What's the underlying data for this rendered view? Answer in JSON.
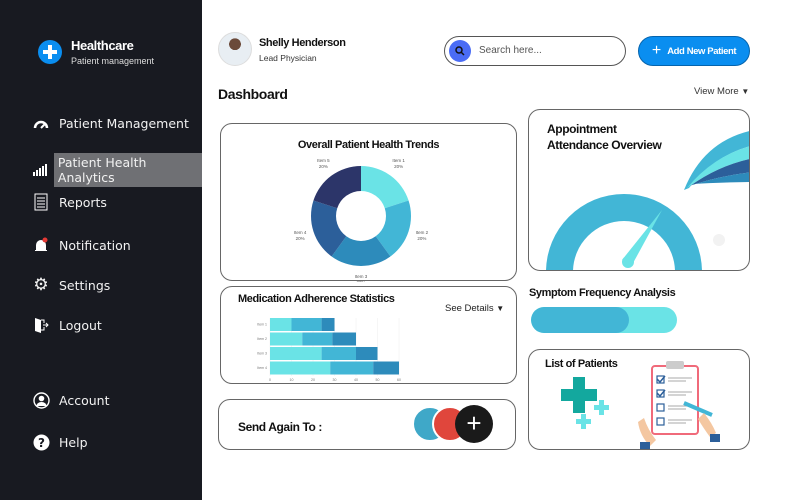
{
  "brand": {
    "title": "Healthcare",
    "subtitle": "Patient management",
    "icon": "plus-circle-icon"
  },
  "sidebar": {
    "items": [
      {
        "label": "Patient Management",
        "icon": "gauge-icon"
      },
      {
        "label": "Patient Health Analytics",
        "icon": "signal-bars-icon",
        "active": true
      },
      {
        "label": "Reports",
        "icon": "document-icon"
      },
      {
        "label": "Notification",
        "icon": "bell-icon"
      },
      {
        "label": "Settings",
        "icon": "gear-icon"
      },
      {
        "label": "Logout",
        "icon": "logout-door-icon"
      }
    ],
    "bottom": [
      {
        "label": "Account",
        "icon": "user-circle-icon"
      },
      {
        "label": "Help",
        "icon": "help-circle-icon"
      }
    ]
  },
  "user": {
    "name": "Shelly Henderson",
    "role": "Lead Physician"
  },
  "search": {
    "placeholder": "Search here..."
  },
  "add_button": "Add New Patient",
  "page_title": "Dashboard",
  "view_more": "View More",
  "colors": {
    "accent": "#0a8ef0",
    "sidebar": "#181a21",
    "c1": "#6ae3e6",
    "c2": "#42b6d6",
    "c3": "#2d8bbb",
    "c4": "#2c5f9a",
    "c5": "#2c3569"
  },
  "health_trends": {
    "title": "Overall Patient Health Trends"
  },
  "medication": {
    "title": "Medication Adherence Statistics",
    "see_details": "See Details"
  },
  "appointment": {
    "title_line1": "Appointment",
    "title_line2": "Attendance Overview",
    "gauge_level": 0.7
  },
  "symptom": {
    "title": "Symptom Frequency Analysis",
    "progress": 0.67
  },
  "patients": {
    "title": "List of Patients"
  },
  "send_again": {
    "label": "Send Again To :"
  },
  "chart_data": [
    {
      "type": "pie",
      "donut": true,
      "categories": [
        "Item 1",
        "Item 2",
        "Item 3",
        "Item 4",
        "Item 5"
      ],
      "values": [
        20,
        20,
        20,
        20,
        20
      ],
      "labels": [
        "20%",
        "20%",
        "20%",
        "20%",
        "20%"
      ]
    },
    {
      "type": "bar",
      "orientation": "horizontal",
      "stacked": true,
      "categories": [
        "Item 1",
        "Item 2",
        "Item 3",
        "Item 4"
      ],
      "series": [
        {
          "values": [
            10,
            15,
            24,
            28
          ]
        },
        {
          "values": [
            14,
            14,
            16,
            20
          ]
        },
        {
          "values": [
            6,
            11,
            10,
            12
          ]
        }
      ],
      "xlim": [
        0,
        60
      ],
      "xticks": [
        "0",
        "10",
        "20",
        "30",
        "40",
        "50",
        "60"
      ],
      "grid": true
    }
  ]
}
